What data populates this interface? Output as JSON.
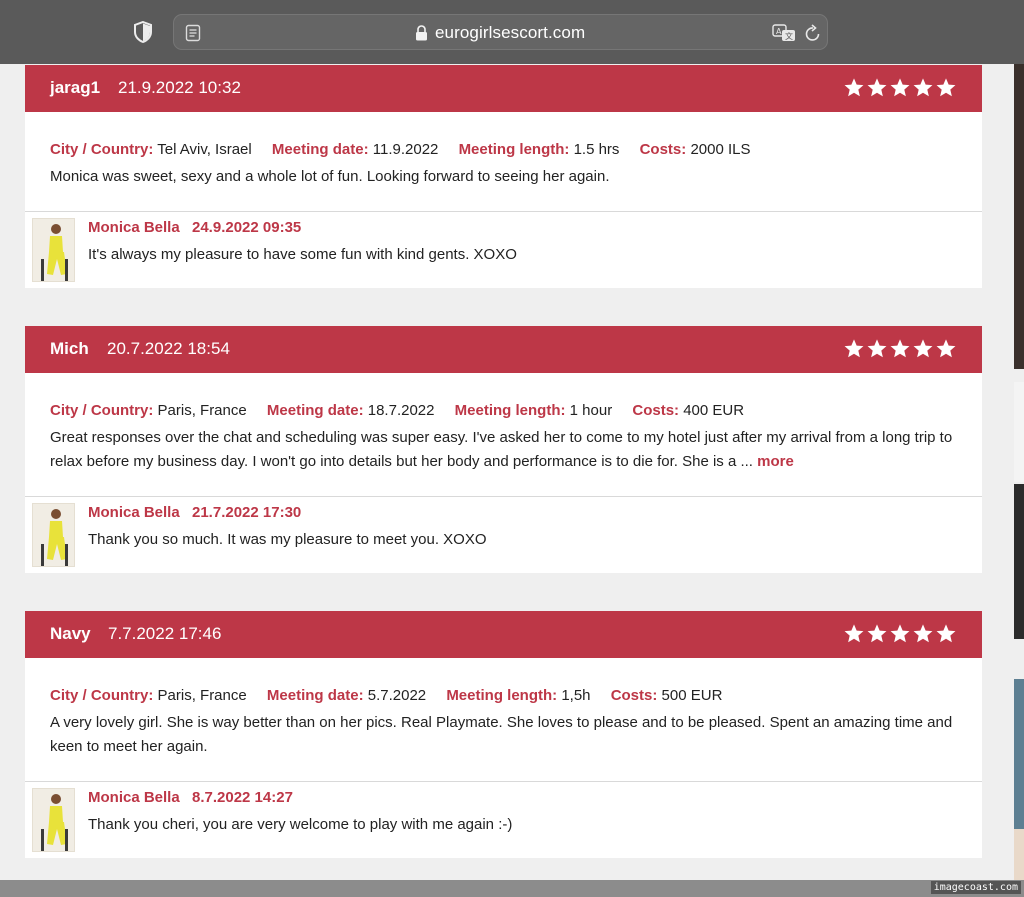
{
  "browser": {
    "url": "eurogirlsescort.com"
  },
  "labels": {
    "city": "City / Country:",
    "meeting_date": "Meeting date:",
    "meeting_length": "Meeting length:",
    "costs": "Costs:",
    "more": "more"
  },
  "reviews": [
    {
      "author": "jarag1",
      "date": "21.9.2022 10:32",
      "rating": 5,
      "city": "Tel Aviv, Israel",
      "meeting_date": "11.9.2022",
      "meeting_length": "1.5 hrs",
      "costs": "2000 ILS",
      "text": "Monica was sweet, sexy and a whole lot of fun. Looking forward to seeing her again.",
      "reply": {
        "author": "Monica Bella",
        "date": "24.9.2022 09:35",
        "text": "It's always my pleasure to have some fun with kind gents. XOXO"
      }
    },
    {
      "author": "Mich",
      "date": "20.7.2022 18:54",
      "rating": 5,
      "city": "Paris, France",
      "meeting_date": "18.7.2022",
      "meeting_length": "1 hour",
      "costs": "400 EUR",
      "text": "Great responses over the chat and scheduling was super easy. I've asked her to come to my hotel just after my arrival from a long trip to relax before my business day. I won't go into details but her body and performance is to die for. She is a ...",
      "reply": {
        "author": "Monica Bella",
        "date": "21.7.2022 17:30",
        "text": "Thank you so much. It was my pleasure to meet you. XOXO"
      }
    },
    {
      "author": "Navy",
      "date": "7.7.2022 17:46",
      "rating": 5,
      "city": "Paris, France",
      "meeting_date": "5.7.2022",
      "meeting_length": "1,5h",
      "costs": "500 EUR",
      "text": "A very lovely girl. She is way better than on her pics. Real Playmate. She loves to please and to be pleased. Spent an amazing time and keen to meet her again.",
      "reply": {
        "author": "Monica Bella",
        "date": "8.7.2022 14:27",
        "text": "Thank you cheri, you are very welcome to play with me again :-)"
      }
    }
  ],
  "watermark": "imagecoast.com",
  "colors": {
    "accent": "#bd3747",
    "toolbar": "#5a5a5a",
    "page_bg": "#efefef"
  },
  "icons": [
    "shield-icon",
    "reader-icon",
    "lock-icon",
    "translate-icon",
    "reload-icon",
    "star-icon"
  ]
}
